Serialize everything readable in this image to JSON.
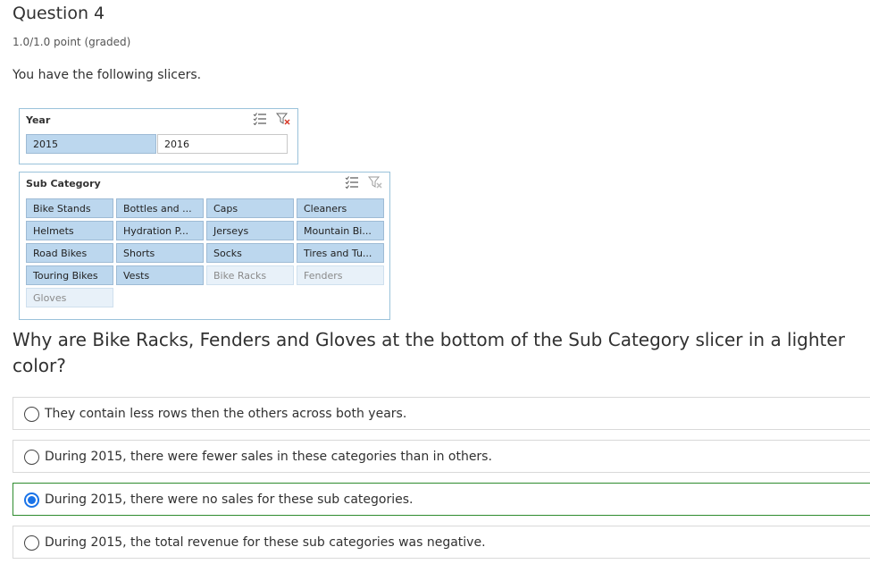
{
  "question": {
    "title": "Question 4",
    "points": "1.0/1.0 point (graded)",
    "intro": "You have the following slicers.",
    "prompt": "Why are Bike Racks, Fenders and Gloves at the bottom of the Sub Category slicer in a lighter color?"
  },
  "slicers": {
    "year": {
      "header": "Year",
      "icons": [
        "multi-select-icon",
        "clear-filter-icon"
      ],
      "items": [
        {
          "label": "2015",
          "state": "selected"
        },
        {
          "label": "2016",
          "state": "unselected"
        }
      ]
    },
    "sub_category": {
      "header": "Sub Category",
      "icons": [
        "multi-select-icon",
        "clear-filter-icon"
      ],
      "items": [
        {
          "label": "Bike Stands",
          "state": "selected"
        },
        {
          "label": "Bottles and ...",
          "state": "selected"
        },
        {
          "label": "Caps",
          "state": "selected"
        },
        {
          "label": "Cleaners",
          "state": "selected"
        },
        {
          "label": "Helmets",
          "state": "selected"
        },
        {
          "label": "Hydration P...",
          "state": "selected"
        },
        {
          "label": "Jerseys",
          "state": "selected"
        },
        {
          "label": "Mountain Bi...",
          "state": "selected"
        },
        {
          "label": "Road Bikes",
          "state": "selected"
        },
        {
          "label": "Shorts",
          "state": "selected"
        },
        {
          "label": "Socks",
          "state": "selected"
        },
        {
          "label": "Tires and Tu...",
          "state": "selected"
        },
        {
          "label": "Touring Bikes",
          "state": "selected"
        },
        {
          "label": "Vests",
          "state": "selected"
        },
        {
          "label": "Bike Racks",
          "state": "no-data"
        },
        {
          "label": "Fenders",
          "state": "no-data"
        },
        {
          "label": "Gloves",
          "state": "no-data"
        }
      ]
    }
  },
  "options": [
    {
      "label": "They contain less rows then the others across both years.",
      "selected": false
    },
    {
      "label": "During 2015, there were fewer sales in these categories than in others.",
      "selected": false
    },
    {
      "label": "During 2015, there were no sales for these sub categories.",
      "selected": true
    },
    {
      "label": "During 2015, the total revenue for these sub categories was negative.",
      "selected": false
    }
  ],
  "colors": {
    "selected_item": "#bcd7ee",
    "no_data_item": "#e8f1f9",
    "slicer_border": "#9ac2da",
    "correct_border": "#2e8b2e",
    "radio_checked": "#1a73e8"
  }
}
